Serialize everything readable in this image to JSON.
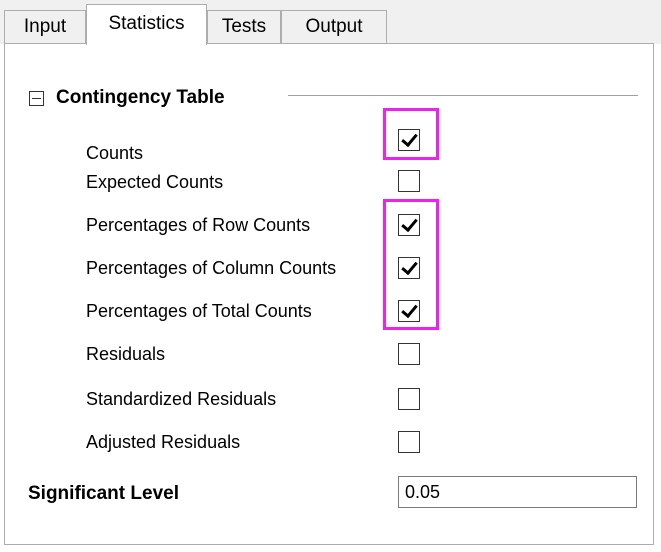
{
  "tabs": [
    {
      "label": "Input",
      "active": false
    },
    {
      "label": "Statistics",
      "active": true
    },
    {
      "label": "Tests",
      "active": false
    },
    {
      "label": "Output",
      "active": false
    }
  ],
  "contingency": {
    "group_title": "Contingency Table",
    "expanded": true,
    "options": [
      {
        "label": "Counts",
        "checked": true,
        "highlighted": true
      },
      {
        "label": "Expected Counts",
        "checked": false,
        "highlighted": false
      },
      {
        "label": "Percentages of Row Counts",
        "checked": true,
        "highlighted": true
      },
      {
        "label": "Percentages of Column Counts",
        "checked": true,
        "highlighted": true
      },
      {
        "label": "Percentages of Total Counts",
        "checked": true,
        "highlighted": true
      },
      {
        "label": "Residuals",
        "checked": false,
        "highlighted": false
      },
      {
        "label": "Standardized Residuals",
        "checked": false,
        "highlighted": false
      },
      {
        "label": "Adjusted Residuals",
        "checked": false,
        "highlighted": false
      }
    ]
  },
  "significance": {
    "label": "Significant Level",
    "value": "0.05"
  },
  "colors": {
    "highlight": "#ee22ee"
  }
}
